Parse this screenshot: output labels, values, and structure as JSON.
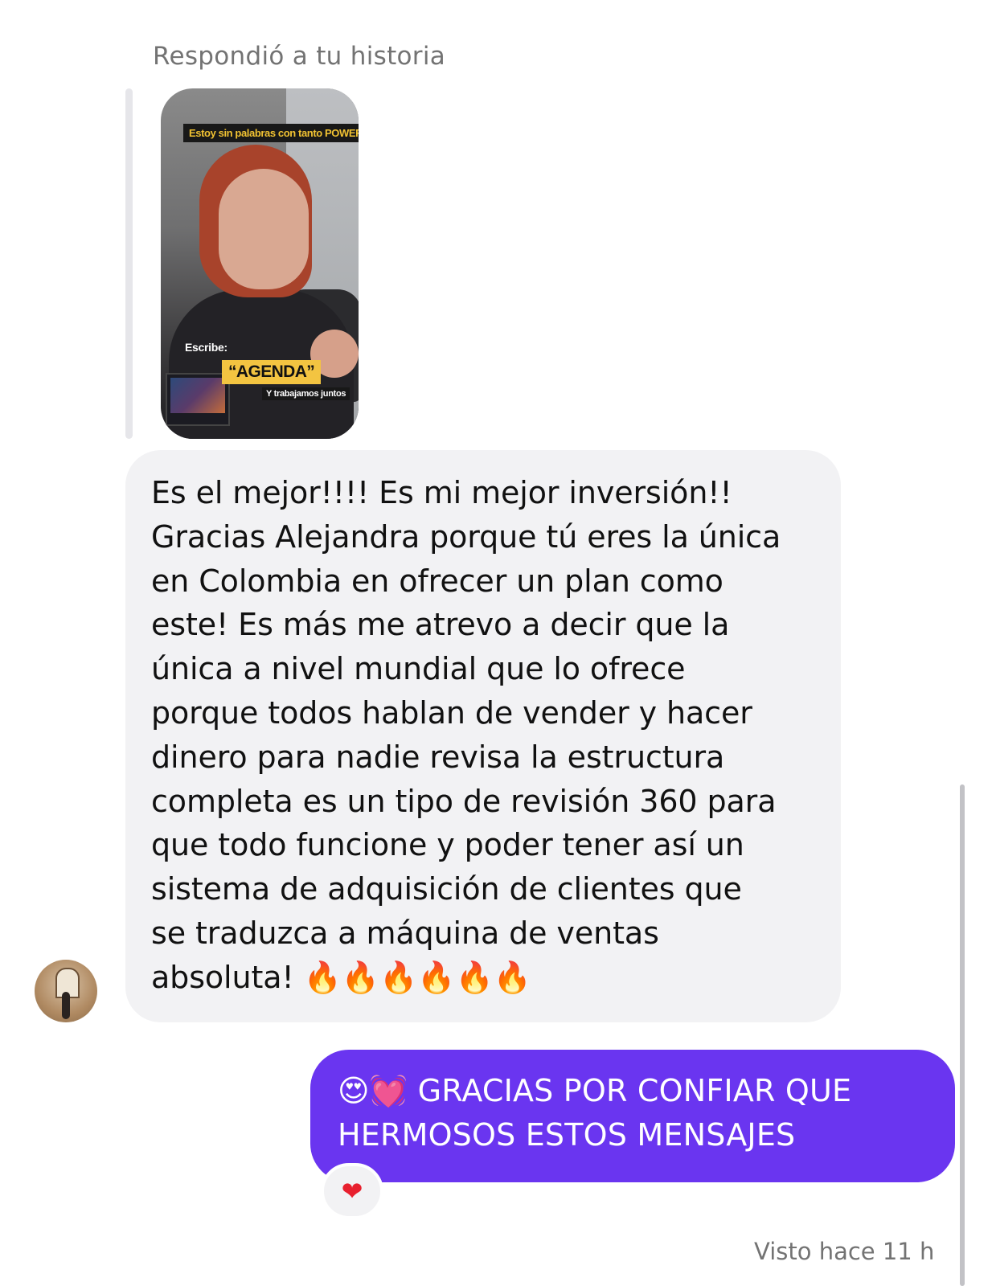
{
  "story_reply": {
    "caption": "Respondió a tu historia",
    "overlay_top": "Estoy sin palabras con tanto POWER!",
    "overlay_write": "Escribe:",
    "overlay_keyword": "“AGENDA”",
    "overlay_bottom": "Y trabajamos juntos"
  },
  "incoming_message": {
    "text": "Es el mejor!!!! Es mi mejor inversión!!\nGracias Alejandra porque tú eres la única\nen Colombia en ofrecer un plan como\neste! Es más me atrevo a decir que la\núnica a nivel mundial que lo ofrece\nporque todos hablan de vender y hacer\ndinero para nadie revisa la estructura\ncompleta es un tipo de revisión 360 para\nque todo funcione y poder tener así un\nsistema de adquisición de clientes que\nse traduzca a máquina de ventas\nabsoluta! 🔥🔥🔥🔥🔥🔥"
  },
  "outgoing_message": {
    "text": "😍💓 GRACIAS POR CONFIAR QUE\nHERMOSOS ESTOS MENSAJES",
    "bubble_color": "#6a35f0"
  },
  "reaction": {
    "emoji": "❤"
  },
  "status": {
    "seen": "Visto hace 11 h"
  }
}
